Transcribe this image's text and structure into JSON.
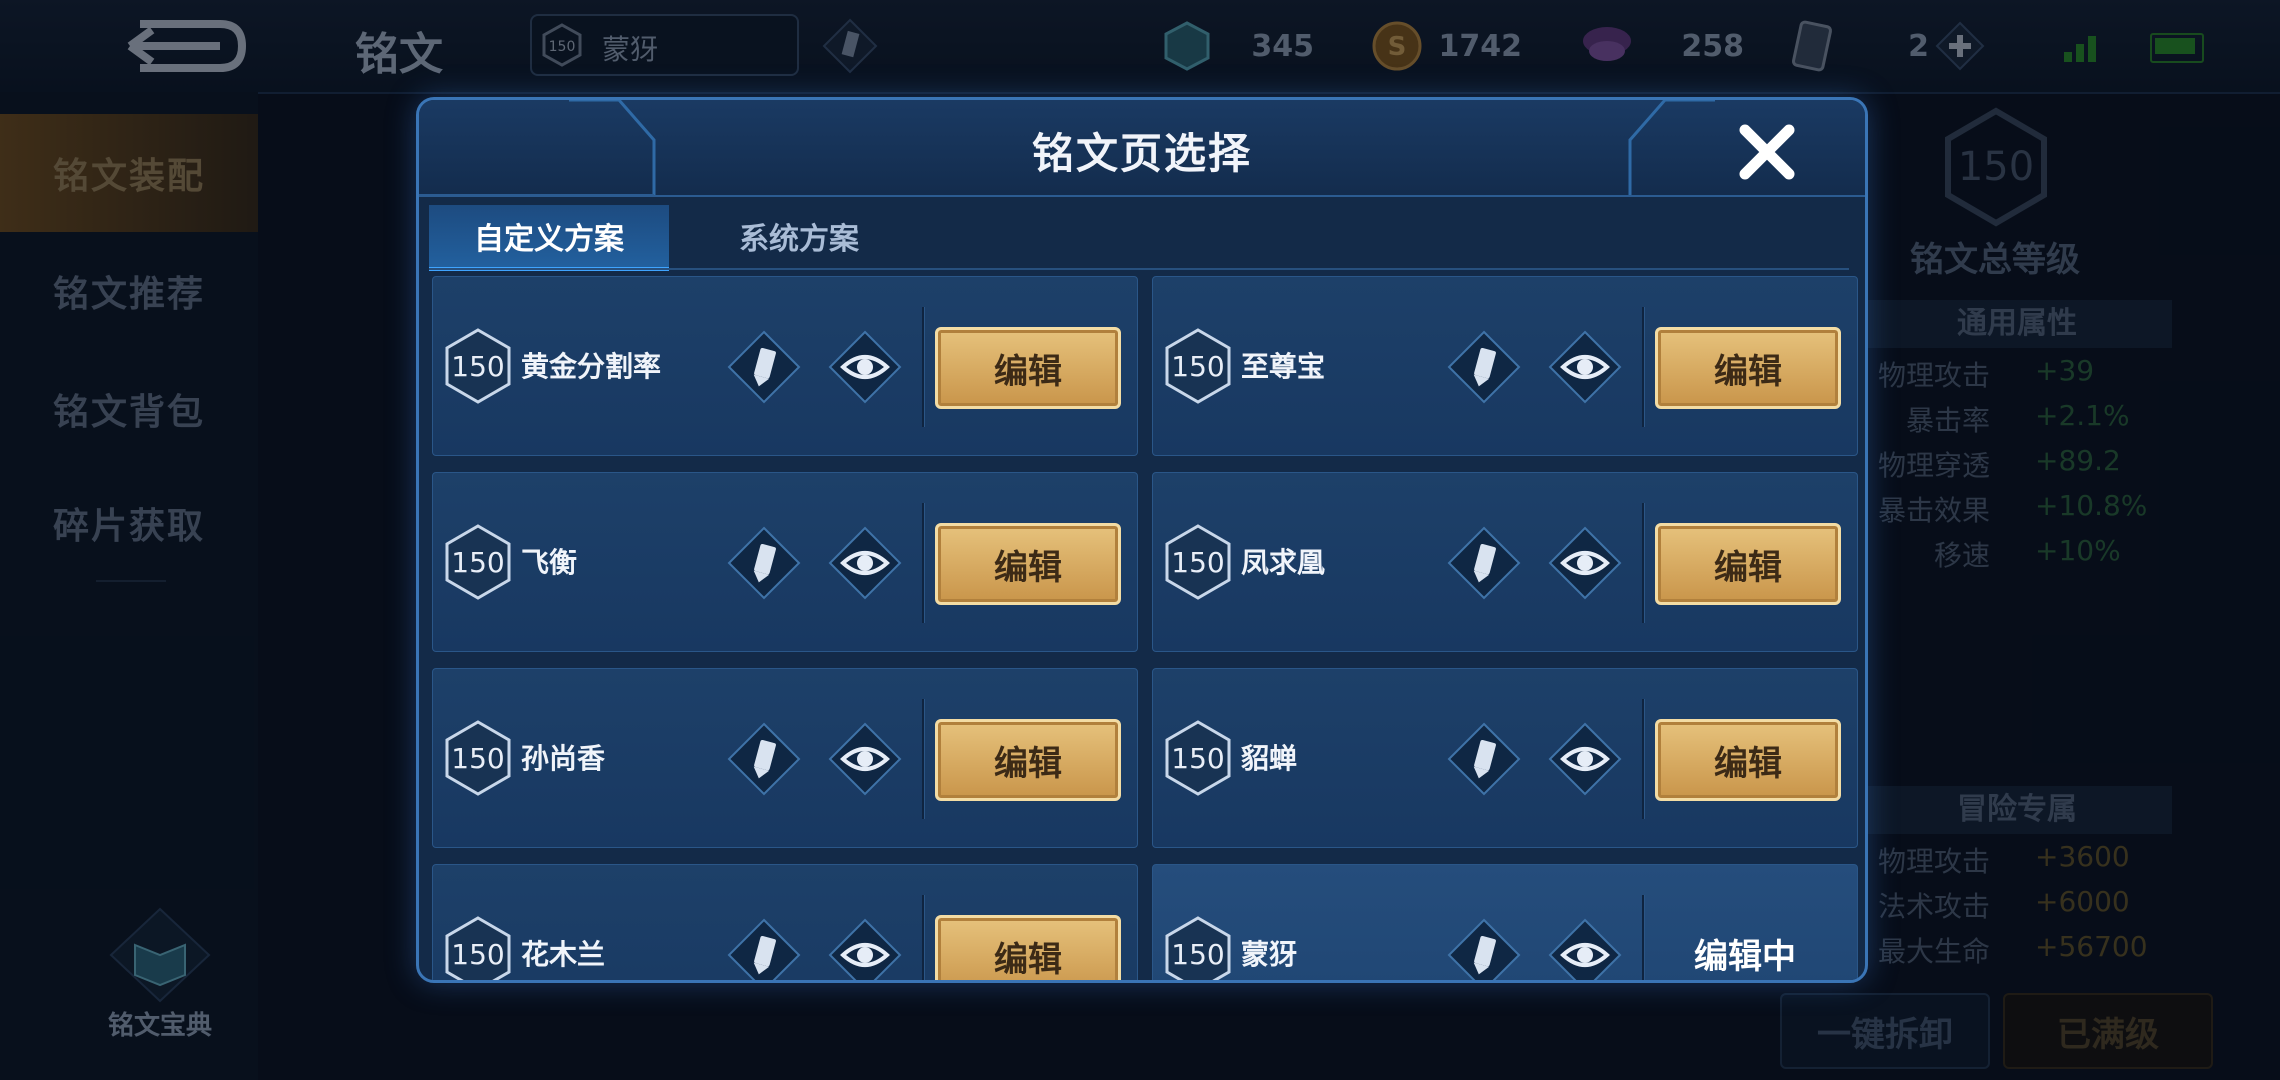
{
  "topbar": {
    "title": "铭文",
    "current_page": {
      "level": "150",
      "name": "蒙犽"
    },
    "currencies": [
      {
        "icon": "crystal-icon",
        "value": "345"
      },
      {
        "icon": "gold-coin-icon",
        "value": "1742"
      },
      {
        "icon": "diamond-icon",
        "value": "258"
      },
      {
        "icon": "card-icon",
        "value": "2"
      }
    ]
  },
  "leftnav": {
    "items": [
      "铭文装配",
      "铭文推荐",
      "铭文背包",
      "碎片获取"
    ],
    "active_index": 0,
    "codex_label": "铭文宝典"
  },
  "right_panel": {
    "total_level": "150",
    "total_label": "铭文总等级",
    "general_header": "通用属性",
    "general_attrs": [
      {
        "name": "物理攻击",
        "value": "+39"
      },
      {
        "name": "暴击率",
        "value": "+2.1%"
      },
      {
        "name": "物理穿透",
        "value": "+89.2"
      },
      {
        "name": "暴击效果",
        "value": "+10.8%"
      },
      {
        "name": "移速",
        "value": "+10%"
      }
    ],
    "adventure_header": "冒险专属",
    "adventure_attrs": [
      {
        "name": "物理攻击",
        "value": "+3600"
      },
      {
        "name": "法术攻击",
        "value": "+6000"
      },
      {
        "name": "最大生命",
        "value": "+56700"
      }
    ],
    "btn_disassemble": "一键拆卸",
    "btn_maxed": "已满级"
  },
  "modal": {
    "title": "铭文页选择",
    "tabs": [
      "自定义方案",
      "系统方案"
    ],
    "active_tab": 0,
    "edit_label": "编辑",
    "editing_label": "编辑中",
    "pages": [
      {
        "level": "150",
        "name": "黄金分割率",
        "state": "edit"
      },
      {
        "level": "150",
        "name": "至尊宝",
        "state": "edit"
      },
      {
        "level": "150",
        "name": "飞衡",
        "state": "edit"
      },
      {
        "level": "150",
        "name": "凤求凰",
        "state": "edit"
      },
      {
        "level": "150",
        "name": "孙尚香",
        "state": "edit"
      },
      {
        "level": "150",
        "name": "貂蝉",
        "state": "edit"
      },
      {
        "level": "150",
        "name": "花木兰",
        "state": "edit"
      },
      {
        "level": "150",
        "name": "蒙犽",
        "state": "editing"
      }
    ]
  },
  "colors": {
    "accent_gold": "#d9ae64",
    "modal_border": "#3a75b6",
    "attr_green": "#2e6b41"
  }
}
